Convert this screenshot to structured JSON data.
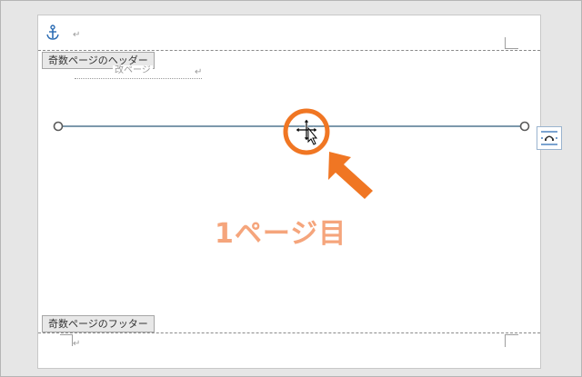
{
  "document": {
    "header_tag": "奇数ページのヘッダー",
    "footer_tag": "奇数ページのフッター",
    "page_break_label": "改ページ",
    "paragraph_mark": "↵"
  },
  "annotation": {
    "caption": "1ページ目",
    "accent_color": "#f07623",
    "caption_color": "#f5a57c"
  },
  "icons": {
    "anchor": "anchor-icon",
    "move_cursor": "move-cursor-icon",
    "layout_options": "layout-options-icon"
  },
  "colors": {
    "line": "#2e5a7a",
    "handle": "#5a5a5a",
    "anchor": "#2b6cb3"
  }
}
